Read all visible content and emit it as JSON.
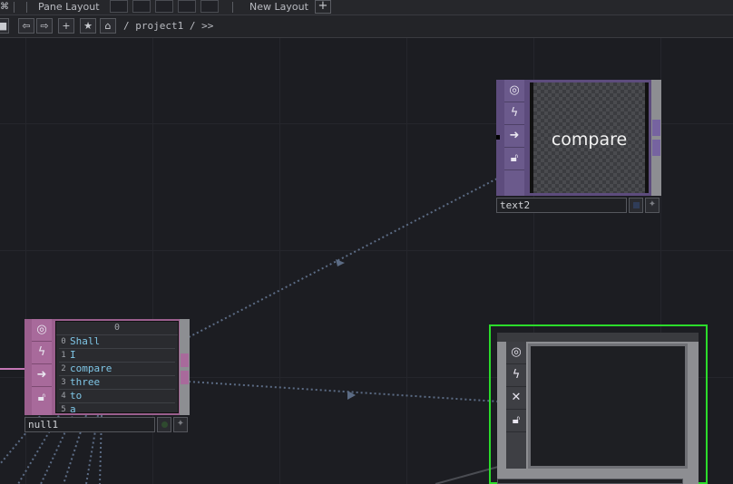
{
  "topbar": {
    "pane_layout_label": "Pane Layout",
    "new_layout_label": "New Layout",
    "plus_label": "+"
  },
  "pathbar": {
    "path_text": "/ project1 / >>"
  },
  "nodes": {
    "text2": {
      "name": "text2",
      "preview_text": "compare"
    },
    "null1": {
      "name": "null1",
      "table_header": "0",
      "rows": [
        {
          "index": "0",
          "value": "Shall"
        },
        {
          "index": "1",
          "value": "I"
        },
        {
          "index": "2",
          "value": "compare"
        },
        {
          "index": "3",
          "value": "three"
        },
        {
          "index": "4",
          "value": "to"
        },
        {
          "index": "5",
          "value": "a"
        }
      ]
    },
    "selected": {
      "name": ""
    }
  },
  "colors": {
    "node_purple": "#6b5a8c",
    "dat_pink": "#b071a5",
    "selected_green": "#2bdc2b",
    "wire_blue": "#5b6b84"
  }
}
